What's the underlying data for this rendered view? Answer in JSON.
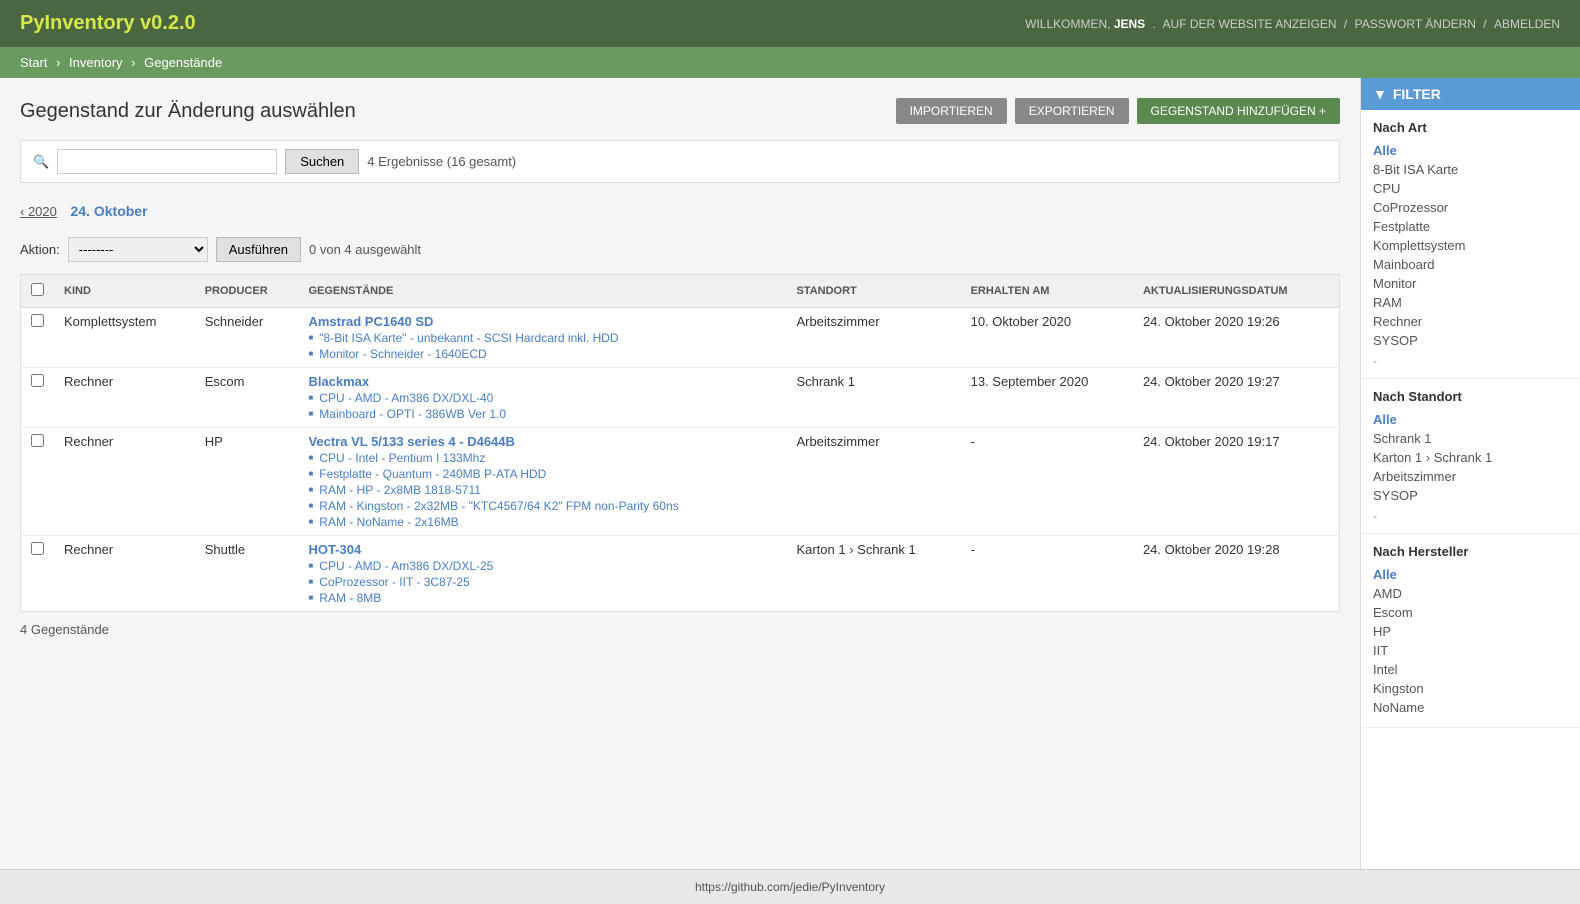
{
  "app": {
    "title": "PyInventory v0.2.0",
    "user": {
      "greeting": "WILLKOMMEN,",
      "name": "JENS",
      "links": [
        "AUF DER WEBSITE ANZEIGEN",
        "PASSWORT ÄNDERN",
        "ABMELDEN"
      ]
    }
  },
  "breadcrumb": {
    "items": [
      "Start",
      "Inventory",
      "Gegenstände"
    ],
    "separators": [
      "›",
      "›"
    ]
  },
  "page": {
    "title": "Gegenstand zur Änderung auswählen"
  },
  "toolbar": {
    "import_label": "IMPORTIEREN",
    "export_label": "EXPORTIEREN",
    "add_label": "GEGENSTAND HINZUFÜGEN +"
  },
  "search": {
    "placeholder": "",
    "button_label": "Suchen",
    "results_text": "4 Ergebnisse (16 gesamt)"
  },
  "date_nav": {
    "prev": "‹ 2020",
    "current": "24. Oktober"
  },
  "action_bar": {
    "label": "Aktion:",
    "default_option": "--------",
    "button_label": "Ausführen",
    "selected_text": "0 von 4 ausgewählt"
  },
  "table": {
    "columns": [
      "",
      "KIND",
      "PRODUCER",
      "GEGENSTÄNDE",
      "STANDORT",
      "ERHALTEN AM",
      "AKTUALISIERUNGSDATUM"
    ],
    "rows": [
      {
        "kind": "Komplettsystem",
        "producer": "Schneider",
        "name": "Amstrad PC1640 SD",
        "sub_items": [
          "\"8-Bit ISA Karte\" - unbekannt - SCSI Hardcard inkl. HDD",
          "Monitor - Schneider - 1640ECD"
        ],
        "standort": "Arbeitszimmer",
        "erhalten": "10. Oktober 2020",
        "aktualisiert": "24. Oktober 2020 19:26"
      },
      {
        "kind": "Rechner",
        "producer": "Escom",
        "name": "Blackmax",
        "sub_items": [
          "CPU - AMD - Am386 DX/DXL-40",
          "Mainboard - OPTI - 386WB Ver 1.0"
        ],
        "standort": "Schrank 1",
        "erhalten": "13. September 2020",
        "aktualisiert": "24. Oktober 2020 19:27"
      },
      {
        "kind": "Rechner",
        "producer": "HP",
        "name": "Vectra VL 5/133 series 4 - D4644B",
        "sub_items": [
          "CPU - Intel - Pentium I 133Mhz",
          "Festplatte - Quantum - 240MB P-ATA HDD",
          "RAM - HP - 2x8MB 1818-5711",
          "RAM - Kingston - 2x32MB - \"KTC4567/64 K2\" FPM non-Parity 60ns",
          "RAM - NoName - 2x16MB"
        ],
        "standort": "Arbeitszimmer",
        "erhalten": "-",
        "aktualisiert": "24. Oktober 2020 19:17"
      },
      {
        "kind": "Rechner",
        "producer": "Shuttle",
        "name": "HOT-304",
        "sub_items": [
          "CPU - AMD - Am386 DX/DXL-25",
          "CoProzessor - IIT - 3C87-25",
          "RAM - 8MB"
        ],
        "standort": "Karton 1 › Schrank 1",
        "erhalten": "-",
        "aktualisiert": "24. Oktober 2020 19:28"
      }
    ]
  },
  "items_count": "4 Gegenstände",
  "filter": {
    "header": "FILTER",
    "sections": [
      {
        "title": "Nach Art",
        "items": [
          "Alle",
          "8-Bit ISA Karte",
          "CPU",
          "CoProzessor",
          "Festplatte",
          "Komplettsystem",
          "Mainboard",
          "Monitor",
          "RAM",
          "Rechner",
          "SYSOP"
        ],
        "more": "-"
      },
      {
        "title": "Nach Standort",
        "items": [
          "Alle",
          "Schrank 1",
          "Karton 1 › Schrank 1",
          "Arbeitszimmer",
          "SYSOP"
        ],
        "more": "-"
      },
      {
        "title": "Nach Hersteller",
        "items": [
          "Alle",
          "AMD",
          "Escom",
          "HP",
          "IIT",
          "Intel",
          "Kingston",
          "NoName"
        ],
        "more": ""
      }
    ]
  },
  "footer": {
    "url": "https://github.com/jedie/PyInventory"
  }
}
